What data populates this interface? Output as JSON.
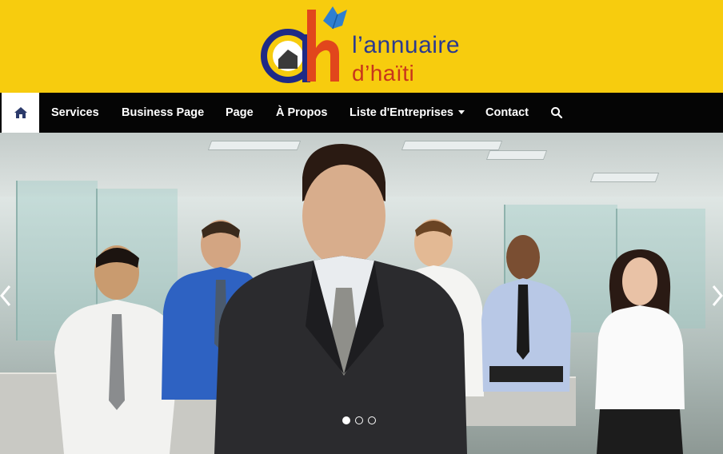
{
  "header": {
    "logo_line1": "l’annuaire",
    "logo_line2": "d’haïti",
    "background": "#f7cc0e"
  },
  "nav": {
    "home_icon": "home-icon",
    "items": [
      {
        "label": "Services"
      },
      {
        "label": "Business Page"
      },
      {
        "label": "Page"
      },
      {
        "label": "À Propos"
      },
      {
        "label": "Liste d'Entreprises"
      },
      {
        "label": "Contact"
      }
    ],
    "search_icon": "search-icon",
    "background": "#050505"
  },
  "hero": {
    "slide_count": 3,
    "active_slide": 1,
    "prev_icon": "chevron-left-icon",
    "next_icon": "chevron-right-icon"
  }
}
